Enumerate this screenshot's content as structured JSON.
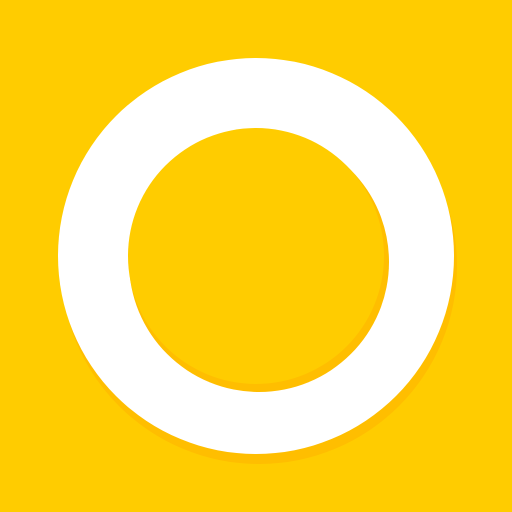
{
  "icon": {
    "name": "ring-logo-icon",
    "colors": {
      "background": "#FFCC00",
      "shadow": "#FFBE00",
      "ring": "#FFFFFF",
      "center": "#FFCC00"
    }
  }
}
